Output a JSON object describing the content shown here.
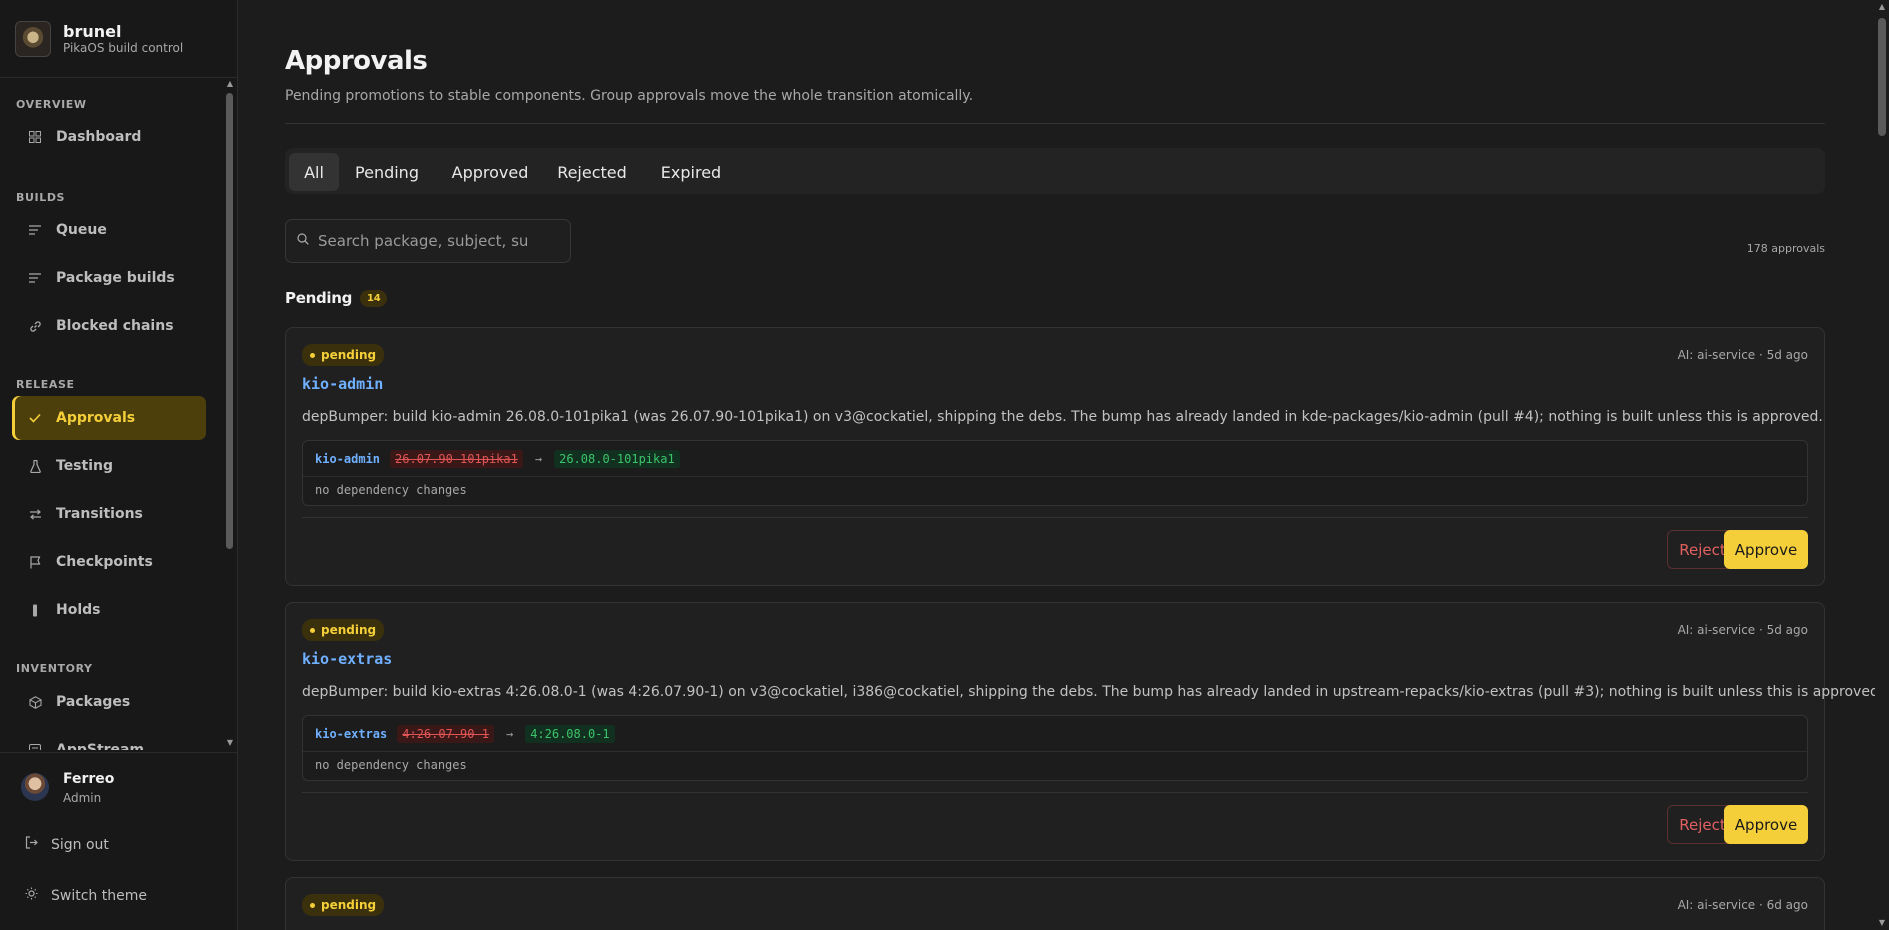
{
  "brand": {
    "name": "brunel",
    "subtitle": "PikaOS build control"
  },
  "sidebar": {
    "sections": [
      {
        "title": "OVERVIEW",
        "items": [
          {
            "label": "Dashboard",
            "icon": "grid-icon"
          }
        ]
      },
      {
        "title": "BUILDS",
        "items": [
          {
            "label": "Queue",
            "icon": "list-icon"
          },
          {
            "label": "Package builds",
            "icon": "list-icon"
          },
          {
            "label": "Blocked chains",
            "icon": "link-icon"
          }
        ]
      },
      {
        "title": "RELEASE",
        "items": [
          {
            "label": "Approvals",
            "icon": "check-icon",
            "active": true
          },
          {
            "label": "Testing",
            "icon": "flask-icon"
          },
          {
            "label": "Transitions",
            "icon": "arrows-icon"
          },
          {
            "label": "Checkpoints",
            "icon": "flag-icon"
          },
          {
            "label": "Holds",
            "icon": "bar-icon"
          }
        ]
      },
      {
        "title": "INVENTORY",
        "items": [
          {
            "label": "Packages",
            "icon": "box-icon"
          },
          {
            "label": "AppStream",
            "icon": "window-icon"
          }
        ]
      }
    ]
  },
  "user": {
    "name": "Ferreo",
    "role": "Admin",
    "sign_out": "Sign out",
    "switch_theme": "Switch theme"
  },
  "page": {
    "title": "Approvals",
    "subtitle": "Pending promotions to stable components. Group approvals move the whole transition atomically.",
    "tabs": [
      "All",
      "Pending",
      "Approved",
      "Rejected",
      "Expired"
    ],
    "active_tab": "All",
    "search_placeholder": "Search package, subject, summary",
    "total": "178 approvals",
    "pending_label": "Pending",
    "pending_count": "14"
  },
  "approvals": [
    {
      "status": "pending",
      "meta": "AI: ai-service · 5d ago",
      "package": "kio-admin",
      "description": "depBumper: build kio-admin 26.08.0-101pika1 (was 26.07.90-101pika1) on v3@cockatiel, shipping the debs. The bump has already landed in kde-packages/kio-admin (pull #4); nothing is built unless this is approved.",
      "diff_name": "kio-admin",
      "old_version": "26.07.90-101pika1",
      "arrow": "→",
      "new_version": "26.08.0-101pika1",
      "deps": "no dependency changes",
      "reject": "Reject",
      "approve": "Approve"
    },
    {
      "status": "pending",
      "meta": "AI: ai-service · 5d ago",
      "package": "kio-extras",
      "description": "depBumper: build kio-extras 4:26.08.0-1 (was 4:26.07.90-1) on v3@cockatiel, i386@cockatiel, shipping the debs. The bump has already landed in upstream-repacks/kio-extras (pull #3); nothing is built unless this is approved.",
      "diff_name": "kio-extras",
      "old_version": "4:26.07.90-1",
      "arrow": "→",
      "new_version": "4:26.08.0-1",
      "deps": "no dependency changes",
      "reject": "Reject",
      "approve": "Approve"
    },
    {
      "status": "pending",
      "meta": "AI: ai-service · 6d ago"
    }
  ],
  "colors": {
    "accent": "#f5cf39",
    "link": "#6fb0ff",
    "danger": "#e06060",
    "success": "#3cc46a"
  }
}
